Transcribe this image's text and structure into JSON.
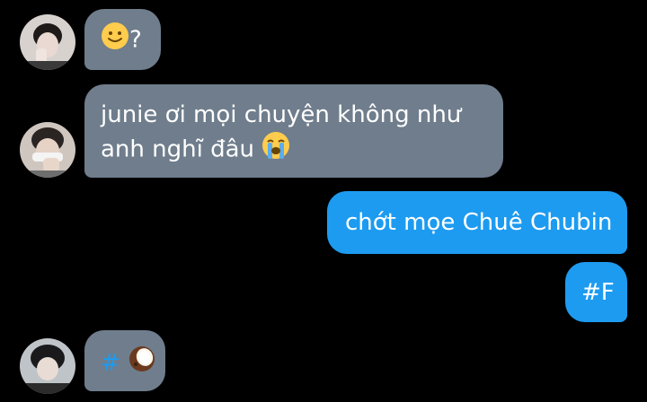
{
  "colors": {
    "background": "#000000",
    "incoming_bubble": "#6f7d8c",
    "outgoing_bubble": "#1d9bf0",
    "hashtag": "#1d9bf0",
    "text": "#ffffff"
  },
  "messages": [
    {
      "direction": "incoming",
      "avatar": "user-avatar-1",
      "emoji": "slightly-smiling-face",
      "text": "?"
    },
    {
      "direction": "incoming",
      "avatar": "user-avatar-2",
      "line1": "junie ơi mọi chuyện không như",
      "line2": "anh nghĩ đâu",
      "emoji": "loudly-crying-face"
    },
    {
      "direction": "outgoing",
      "text": "chớt mọe Chuê Chubin"
    },
    {
      "direction": "outgoing",
      "text": "#F"
    },
    {
      "direction": "incoming",
      "avatar": "user-avatar-3",
      "text": "#",
      "emoji": "coconut"
    }
  ]
}
